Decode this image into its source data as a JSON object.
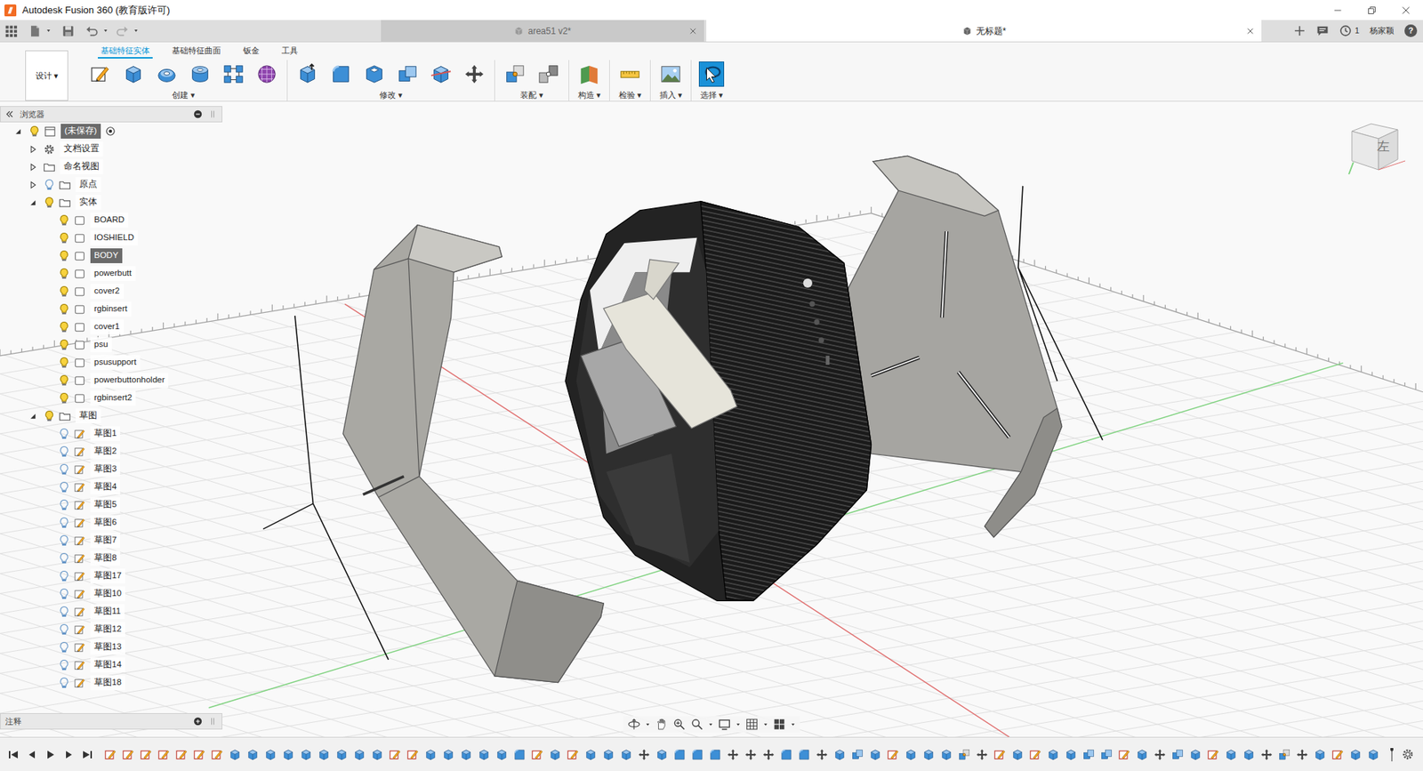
{
  "window": {
    "title": "Autodesk Fusion 360 (教育版许可)"
  },
  "doc_tabs": [
    {
      "label": "area51 v2*",
      "selected": false
    },
    {
      "label": "无标题*",
      "selected": true
    }
  ],
  "account": {
    "jobs": "1",
    "user": "杨家颖",
    "help": "?"
  },
  "workspace": {
    "label": "设计 ▾"
  },
  "ribbon_tabs": [
    {
      "label": "基础特征实体",
      "selected": true
    },
    {
      "label": "基础特征曲面",
      "selected": false
    },
    {
      "label": "钣金",
      "selected": false
    },
    {
      "label": "工具",
      "selected": false
    }
  ],
  "ribbon_groups": [
    {
      "label": "创建 ▾",
      "tools": [
        {
          "kind": "sketch",
          "selected": false
        },
        {
          "kind": "extrude",
          "selected": false
        },
        {
          "kind": "revolve",
          "selected": false
        },
        {
          "kind": "hole",
          "selected": false
        },
        {
          "kind": "pattern",
          "selected": false
        },
        {
          "kind": "form",
          "selected": false
        }
      ]
    },
    {
      "label": "修改 ▾",
      "tools": [
        {
          "kind": "presspull",
          "selected": false
        },
        {
          "kind": "fillet",
          "selected": false
        },
        {
          "kind": "shell",
          "selected": false
        },
        {
          "kind": "combine",
          "selected": false
        },
        {
          "kind": "split",
          "selected": false
        },
        {
          "kind": "move",
          "selected": false
        }
      ]
    },
    {
      "label": "装配 ▾",
      "tools": [
        {
          "kind": "joint",
          "selected": false
        },
        {
          "kind": "asbuilt",
          "selected": false
        }
      ]
    },
    {
      "label": "构造 ▾",
      "tools": [
        {
          "kind": "plane",
          "selected": false
        }
      ]
    },
    {
      "label": "检验 ▾",
      "tools": [
        {
          "kind": "measure",
          "selected": false
        }
      ]
    },
    {
      "label": "插入 ▾",
      "tools": [
        {
          "kind": "image",
          "selected": false
        }
      ]
    },
    {
      "label": "选择 ▾",
      "tools": [
        {
          "kind": "select",
          "selected": true
        }
      ]
    }
  ],
  "browser": {
    "title": "浏览器",
    "tree": {
      "label": "(未保存)",
      "kind": "component",
      "visible": true,
      "expanded": true,
      "selected": true,
      "active": true,
      "children": [
        {
          "label": "文档设置",
          "kind": "settings",
          "expanded": false,
          "selected": false
        },
        {
          "label": "命名视图",
          "kind": "folder",
          "expanded": false,
          "selected": false
        },
        {
          "label": "原点",
          "kind": "folder",
          "visible": false,
          "expanded": false,
          "selected": false
        },
        {
          "label": "实体",
          "kind": "folder",
          "visible": true,
          "expanded": true,
          "selected": false,
          "children": [
            {
              "label": "BOARD",
              "kind": "body",
              "visible": true,
              "selected": false
            },
            {
              "label": "IOSHIELD",
              "kind": "body",
              "visible": true,
              "selected": false
            },
            {
              "label": "BODY",
              "kind": "body",
              "visible": true,
              "selected": true
            },
            {
              "label": "powerbutt",
              "kind": "body",
              "visible": true,
              "selected": false
            },
            {
              "label": "cover2",
              "kind": "body",
              "visible": true,
              "selected": false
            },
            {
              "label": "rgbinsert",
              "kind": "body",
              "visible": true,
              "selected": false
            },
            {
              "label": "cover1",
              "kind": "body",
              "visible": true,
              "selected": false
            },
            {
              "label": "psu",
              "kind": "body",
              "visible": true,
              "selected": false
            },
            {
              "label": "psusupport",
              "kind": "body",
              "visible": true,
              "selected": false
            },
            {
              "label": "powerbuttonholder",
              "kind": "body",
              "visible": true,
              "selected": false
            },
            {
              "label": "rgbinsert2",
              "kind": "body",
              "visible": true,
              "selected": false
            }
          ]
        },
        {
          "label": "草图",
          "kind": "folder",
          "visible": true,
          "expanded": true,
          "selected": false,
          "children": [
            {
              "label": "草图1",
              "kind": "sketch",
              "visible": false,
              "selected": false
            },
            {
              "label": "草图2",
              "kind": "sketch",
              "visible": false,
              "selected": false
            },
            {
              "label": "草图3",
              "kind": "sketch",
              "visible": false,
              "selected": false
            },
            {
              "label": "草图4",
              "kind": "sketch",
              "visible": false,
              "selected": false
            },
            {
              "label": "草图5",
              "kind": "sketch",
              "visible": false,
              "selected": false
            },
            {
              "label": "草图6",
              "kind": "sketch",
              "visible": false,
              "selected": false
            },
            {
              "label": "草图7",
              "kind": "sketch",
              "visible": false,
              "selected": false
            },
            {
              "label": "草图8",
              "kind": "sketch",
              "visible": false,
              "selected": false
            },
            {
              "label": "草图17",
              "kind": "sketch",
              "visible": false,
              "selected": false
            },
            {
              "label": "草图10",
              "kind": "sketch",
              "visible": false,
              "selected": false
            },
            {
              "label": "草图11",
              "kind": "sketch",
              "visible": false,
              "selected": false
            },
            {
              "label": "草图12",
              "kind": "sketch",
              "visible": false,
              "selected": false
            },
            {
              "label": "草图13",
              "kind": "sketch",
              "visible": false,
              "selected": false
            },
            {
              "label": "草图14",
              "kind": "sketch",
              "visible": false,
              "selected": false
            },
            {
              "label": "草图18",
              "kind": "sketch",
              "visible": false,
              "selected": false
            }
          ]
        }
      ]
    }
  },
  "viewcube": {
    "face": "左"
  },
  "comments": {
    "title": "注释"
  },
  "timeline": {
    "features": [
      {
        "kind": "sketch"
      },
      {
        "kind": "sketch"
      },
      {
        "kind": "sketch"
      },
      {
        "kind": "sketch"
      },
      {
        "kind": "sketch"
      },
      {
        "kind": "sketch"
      },
      {
        "kind": "sketch"
      },
      {
        "kind": "extrude"
      },
      {
        "kind": "extrude"
      },
      {
        "kind": "extrude"
      },
      {
        "kind": "extrude"
      },
      {
        "kind": "extrude"
      },
      {
        "kind": "extrude"
      },
      {
        "kind": "extrude"
      },
      {
        "kind": "extrude"
      },
      {
        "kind": "extrude"
      },
      {
        "kind": "sketch"
      },
      {
        "kind": "sketch"
      },
      {
        "kind": "extrude"
      },
      {
        "kind": "extrude"
      },
      {
        "kind": "extrude"
      },
      {
        "kind": "extrude"
      },
      {
        "kind": "extrude"
      },
      {
        "kind": "fillet"
      },
      {
        "kind": "sketch"
      },
      {
        "kind": "extrude"
      },
      {
        "kind": "sketch"
      },
      {
        "kind": "extrude"
      },
      {
        "kind": "extrude"
      },
      {
        "kind": "extrude"
      },
      {
        "kind": "move"
      },
      {
        "kind": "extrude"
      },
      {
        "kind": "fillet"
      },
      {
        "kind": "fillet"
      },
      {
        "kind": "fillet"
      },
      {
        "kind": "move"
      },
      {
        "kind": "move"
      },
      {
        "kind": "move"
      },
      {
        "kind": "fillet"
      },
      {
        "kind": "fillet"
      },
      {
        "kind": "move"
      },
      {
        "kind": "extrude"
      },
      {
        "kind": "combine"
      },
      {
        "kind": "extrude"
      },
      {
        "kind": "sketch"
      },
      {
        "kind": "extrude"
      },
      {
        "kind": "extrude"
      },
      {
        "kind": "extrude"
      },
      {
        "kind": "joint"
      },
      {
        "kind": "move"
      },
      {
        "kind": "sketch"
      },
      {
        "kind": "extrude"
      },
      {
        "kind": "sketch"
      },
      {
        "kind": "extrude"
      },
      {
        "kind": "extrude"
      },
      {
        "kind": "combine"
      },
      {
        "kind": "combine"
      },
      {
        "kind": "sketch"
      },
      {
        "kind": "extrude"
      },
      {
        "kind": "move"
      },
      {
        "kind": "combine"
      },
      {
        "kind": "extrude"
      },
      {
        "kind": "sketch"
      },
      {
        "kind": "extrude"
      },
      {
        "kind": "extrude"
      },
      {
        "kind": "move"
      },
      {
        "kind": "joint"
      },
      {
        "kind": "move"
      },
      {
        "kind": "extrude"
      },
      {
        "kind": "sketch"
      },
      {
        "kind": "extrude"
      },
      {
        "kind": "extrude"
      }
    ]
  }
}
